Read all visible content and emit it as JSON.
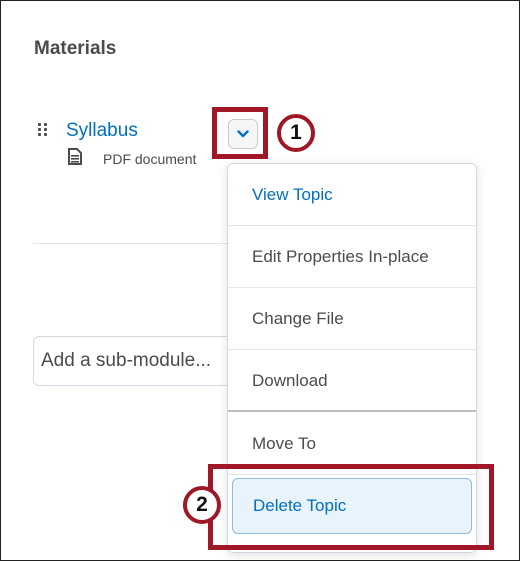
{
  "section": {
    "title": "Materials"
  },
  "topic": {
    "title": "Syllabus",
    "type_label": "PDF document",
    "drag_icon": "drag-handle-icon",
    "doc_icon": "document-icon"
  },
  "actions_button": {
    "icon": "chevron-down-icon"
  },
  "submodule": {
    "placeholder": "Add a sub-module..."
  },
  "context_menu": {
    "items": [
      {
        "label": "View Topic"
      },
      {
        "label": "Edit Properties In-place"
      },
      {
        "label": "Change File"
      },
      {
        "label": "Download"
      },
      {
        "label": "Move To"
      },
      {
        "label": "Delete Topic"
      }
    ]
  },
  "callouts": {
    "step1": "1",
    "step2": "2"
  },
  "colors": {
    "link": "#006fbf",
    "text": "#494c4e",
    "callout": "#a01728",
    "active_bg": "#e8f3fc",
    "active_border": "#89bde3"
  }
}
